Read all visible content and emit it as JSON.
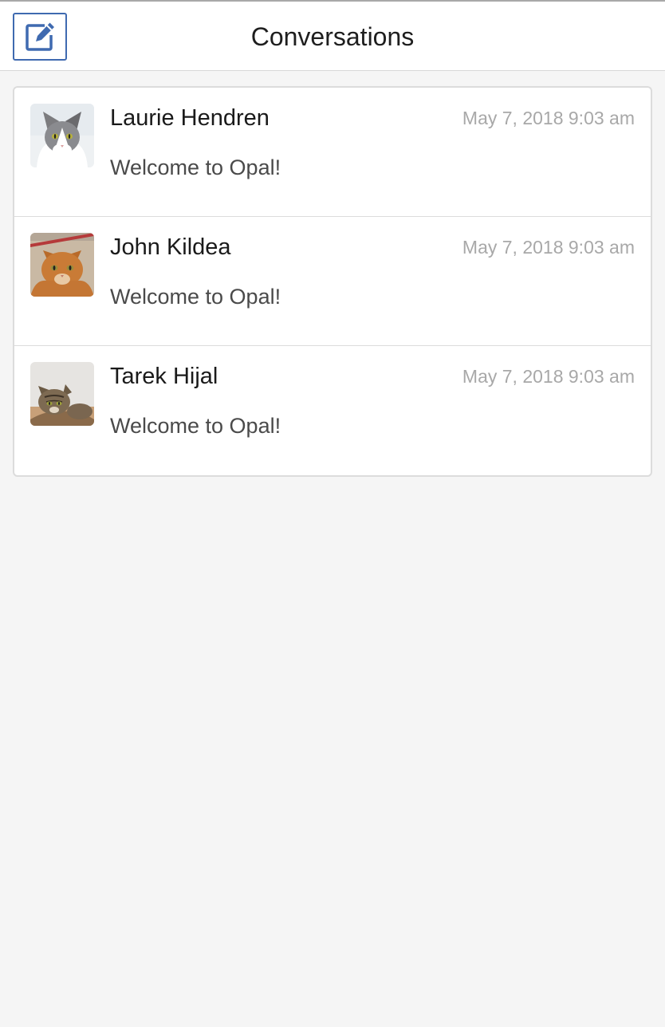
{
  "header": {
    "title": "Conversations",
    "compose_icon": "compose-icon",
    "accent_color": "#3f6ab0"
  },
  "conversations": [
    {
      "name": "Laurie Hendren",
      "timestamp": "May 7, 2018 9:03 am",
      "preview": "Welcome to Opal!",
      "avatar": "gray-white-cat-photo"
    },
    {
      "name": "John Kildea",
      "timestamp": "May 7, 2018 9:03 am",
      "preview": "Welcome to Opal!",
      "avatar": "orange-tabby-cat-photo"
    },
    {
      "name": "Tarek Hijal",
      "timestamp": "May 7, 2018 9:03 am",
      "preview": "Welcome to Opal!",
      "avatar": "brown-tabby-cat-photo"
    }
  ]
}
